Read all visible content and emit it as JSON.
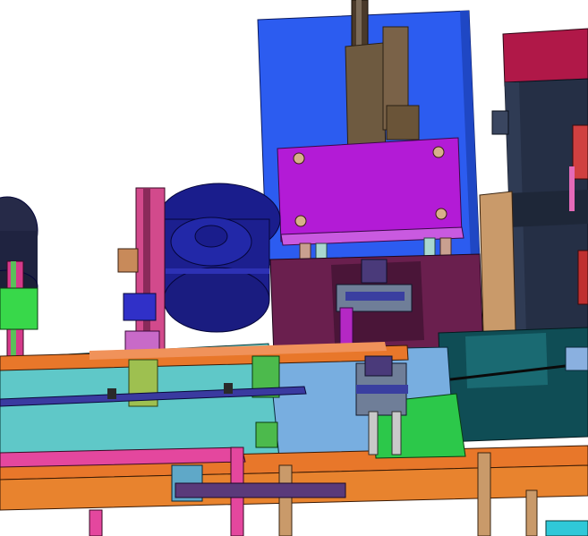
{
  "scene": {
    "kind": "cad-assembly-render",
    "background": "#ffffff",
    "colors": {
      "blue_panel": "#2f5ff0",
      "magenta_plate": "#b41bd8",
      "purple_frame": "#6c2150",
      "navy_bowl": "#1c1f8f",
      "teal_deck": "#5fc8c8",
      "orange_rail": "#e8772a",
      "pink_frame": "#e4479e",
      "slate_cabinet": "#252f45",
      "green_block": "#59c85a",
      "tan_panel": "#c99a6a",
      "dark_teal_box": "#0f4d55",
      "gray_rod": "#c9c9c9",
      "cylinder_brown": "#6e5238"
    }
  }
}
